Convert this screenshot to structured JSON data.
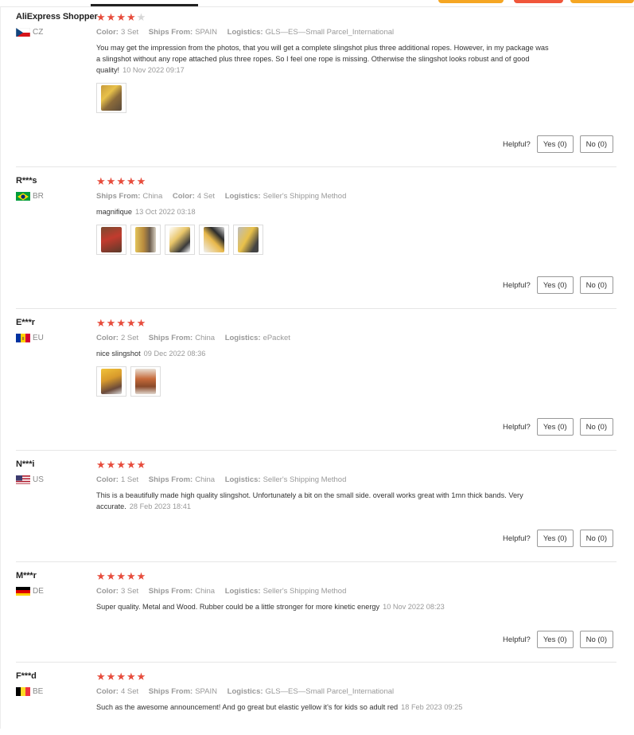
{
  "reviews": [
    {
      "user": "AliExpress Shopper",
      "country": "CZ",
      "stars": 4,
      "attributes": [
        {
          "key": "Color:",
          "value": "3 Set"
        },
        {
          "key": "Ships From:",
          "value": "SPAIN"
        },
        {
          "key": "Logistics:",
          "value": "GLS—ES—Small Parcel_International"
        }
      ],
      "text": "You may get the impression from the photos, that you will get a complete slingshot plus three additional ropes. However, in my package was a slingshot without any rope attached plus three ropes. So I feel one rope is missing. Otherwise the slingshot looks robust and of good quality!",
      "date": "10 Nov 2022 09:17",
      "images": 1,
      "helpful_label": "Helpful?",
      "yes": "Yes (0)",
      "no": "No (0)"
    },
    {
      "user": "R***s",
      "country": "BR",
      "stars": 5,
      "attributes": [
        {
          "key": "Ships From:",
          "value": "China"
        },
        {
          "key": "Color:",
          "value": "4 Set"
        },
        {
          "key": "Logistics:",
          "value": "Seller's Shipping Method"
        }
      ],
      "text": "magnifique",
      "date": "13 Oct 2022 03:18",
      "images": 5,
      "helpful_label": "Helpful?",
      "yes": "Yes (0)",
      "no": "No (0)"
    },
    {
      "user": "E***r",
      "country": "EU",
      "stars": 5,
      "attributes": [
        {
          "key": "Color:",
          "value": "2 Set"
        },
        {
          "key": "Ships From:",
          "value": "China"
        },
        {
          "key": "Logistics:",
          "value": "ePacket"
        }
      ],
      "text": "nice slingshot",
      "date": "09 Dec 2022 08:36",
      "images": 2,
      "helpful_label": "Helpful?",
      "yes": "Yes (0)",
      "no": "No (0)"
    },
    {
      "user": "N***i",
      "country": "US",
      "stars": 5,
      "attributes": [
        {
          "key": "Color:",
          "value": "1 Set"
        },
        {
          "key": "Ships From:",
          "value": "China"
        },
        {
          "key": "Logistics:",
          "value": "Seller's Shipping Method"
        }
      ],
      "text": "This is a beautifully made high quality slingshot. Unfortunately a bit on the small side. overall works great with 1mn thick bands. Very accurate.",
      "date": "28 Feb 2023 18:41",
      "images": 0,
      "helpful_label": "Helpful?",
      "yes": "Yes (0)",
      "no": "No (0)"
    },
    {
      "user": "M***r",
      "country": "DE",
      "stars": 5,
      "attributes": [
        {
          "key": "Color:",
          "value": "3 Set"
        },
        {
          "key": "Ships From:",
          "value": "China"
        },
        {
          "key": "Logistics:",
          "value": "Seller's Shipping Method"
        }
      ],
      "text": "Super quality. Metal and Wood. Rubber could be a little stronger for more kinetic energy",
      "date": "10 Nov 2022 08:23",
      "images": 0,
      "helpful_label": "Helpful?",
      "yes": "Yes (0)",
      "no": "No (0)"
    },
    {
      "user": "F***d",
      "country": "BE",
      "stars": 5,
      "attributes": [
        {
          "key": "Color:",
          "value": "4 Set"
        },
        {
          "key": "Ships From:",
          "value": "SPAIN"
        },
        {
          "key": "Logistics:",
          "value": "GLS—ES—Small Parcel_International"
        }
      ],
      "text": "Such as the awesome announcement! And go great but elastic yellow it's for kids so adult red",
      "date": "18 Feb 2023 09:25",
      "images": 0,
      "helpful_label": "",
      "yes": "",
      "no": ""
    }
  ],
  "colors": {
    "star_on": "#e74c3c",
    "star_off": "#d6d6d6",
    "accent_orange": "#f5a623",
    "accent_red": "#f0563a"
  }
}
